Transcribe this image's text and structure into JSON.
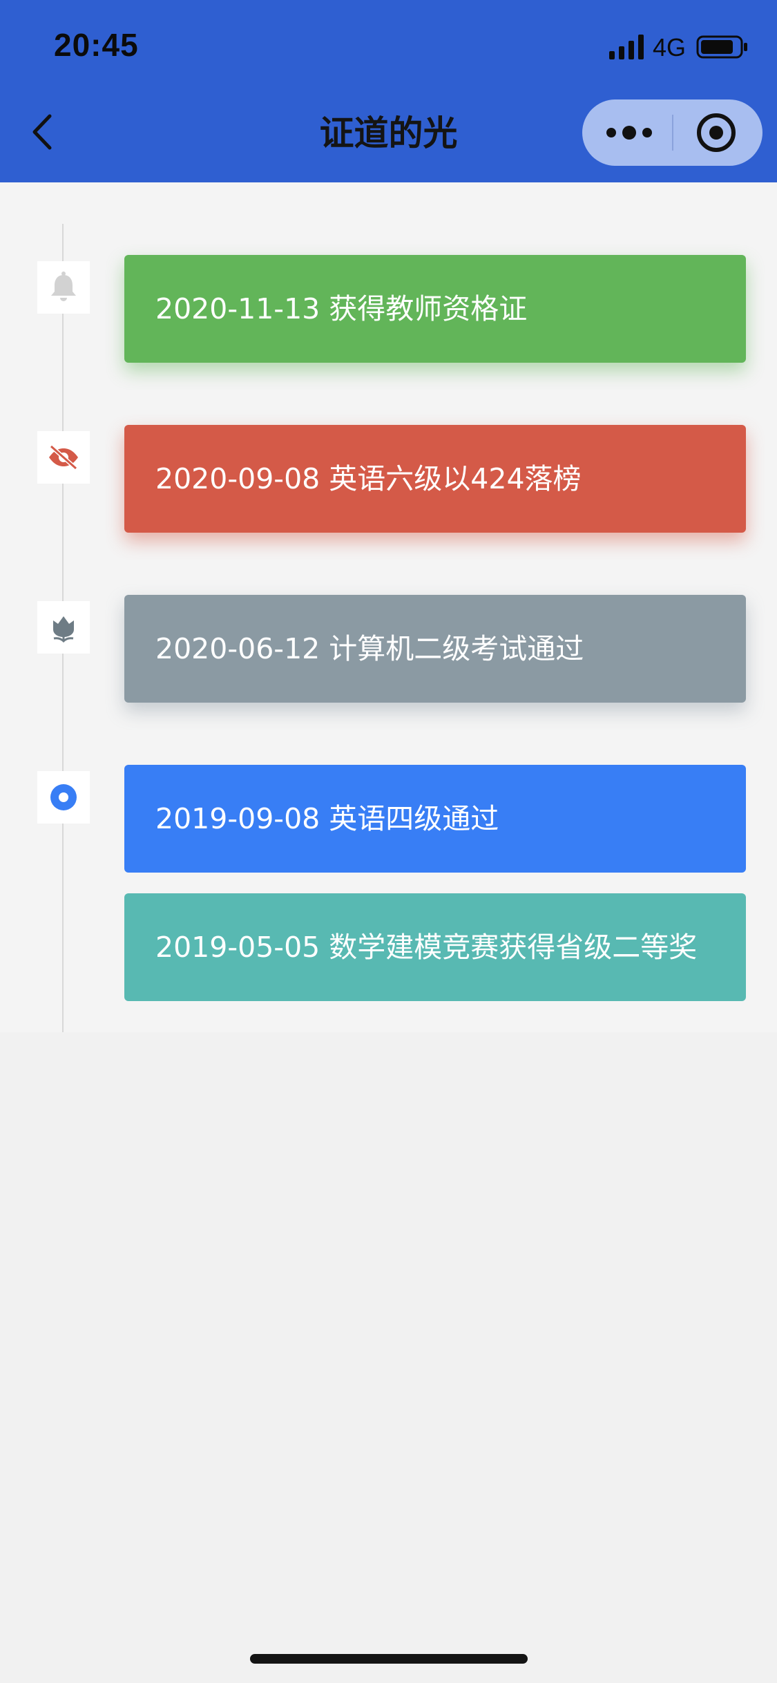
{
  "status_bar": {
    "time": "20:45",
    "network": "4G"
  },
  "nav": {
    "title": "证道的光"
  },
  "timeline": {
    "items": [
      {
        "text": "2020-11-13 获得教师资格证",
        "color": "#62b559",
        "icon": "bell-icon"
      },
      {
        "text": "2020-09-08 英语六级以424落榜",
        "color": "#d45a48",
        "icon": "eye-slash-icon"
      },
      {
        "text": "2020-06-12 计算机二级考试通过",
        "color": "#8b9aa3",
        "icon": "lotus-icon"
      },
      {
        "text": "2019-09-08 英语四级通过",
        "color": "#387ef5",
        "icon": "radio-dot-icon"
      },
      {
        "text": "2019-05-05 数学建模竞赛获得省级二等奖",
        "color": "#58b9b2",
        "icon": ""
      }
    ]
  },
  "colors": {
    "header": "#2f5fd1",
    "capsule": "#a8bef0",
    "content_bg": "#f4f4f4",
    "page_bg": "#f1f1f1"
  }
}
